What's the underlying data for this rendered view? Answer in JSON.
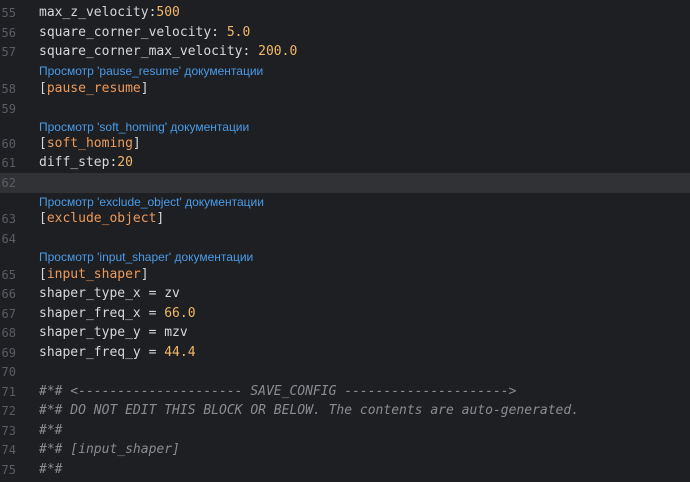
{
  "editor": {
    "lines": [
      {
        "number": "55",
        "key": "max_z_velocity:",
        "value": "500"
      },
      {
        "number": "56",
        "key": "square_corner_velocity: ",
        "value": "5.0"
      },
      {
        "number": "57",
        "key": "square_corner_max_velocity: ",
        "value": "200.0"
      },
      {
        "number": "58",
        "section": "pause_resume"
      },
      {
        "number": "59"
      },
      {
        "number": "60",
        "section": "soft_homing"
      },
      {
        "number": "61",
        "key": "diff_step:",
        "value": "20"
      },
      {
        "number": "62"
      },
      {
        "number": "63",
        "section": "exclude_object"
      },
      {
        "number": "64"
      },
      {
        "number": "65",
        "section": "input_shaper"
      },
      {
        "number": "66",
        "key": "shaper_type_x = ",
        "value": "zv"
      },
      {
        "number": "67",
        "key": "shaper_freq_x = ",
        "value": "66.0"
      },
      {
        "number": "68",
        "key": "shaper_type_y = ",
        "value": "mzv"
      },
      {
        "number": "69",
        "key": "shaper_freq_y = ",
        "value": "44.4"
      },
      {
        "number": "70"
      },
      {
        "number": "71",
        "comment": "#*# <--------------------- SAVE_CONFIG --------------------->"
      },
      {
        "number": "72",
        "comment": "#*# DO NOT EDIT THIS BLOCK OR BELOW. The contents are auto-generated."
      },
      {
        "number": "73",
        "comment": "#*#"
      },
      {
        "number": "74",
        "comment": "#*# [input_shaper]"
      },
      {
        "number": "75",
        "comment": "#*#"
      }
    ],
    "doc_links": [
      {
        "text": "Просмотр 'pause_resume' документации"
      },
      {
        "text": "Просмотр 'soft_homing' документации"
      },
      {
        "text": "Просмотр 'exclude_object' документации"
      },
      {
        "text": "Просмотр 'input_shaper' документации"
      }
    ],
    "bracket_open": "[",
    "bracket_close": "]"
  },
  "colors": {
    "background": "#1e1f22",
    "active_line": "#313236",
    "number_value": "#f0b869",
    "section_name": "#ee9a5a",
    "doc_link": "#4a9be8",
    "comment": "#8a8c91"
  }
}
